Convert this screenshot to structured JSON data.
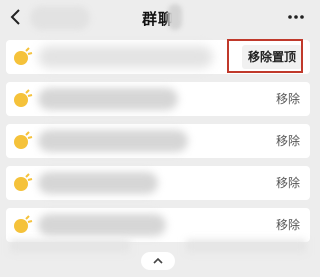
{
  "header": {
    "title": "群聊",
    "back_icon": "chevron-left-icon",
    "more_icon": "more-horizontal-icon"
  },
  "group_list": {
    "items": [
      {
        "avatar_icon": "group-avatar-icon",
        "action_label": "移除置顶",
        "pinned": true
      },
      {
        "avatar_icon": "group-avatar-icon",
        "action_label": "移除",
        "pinned": false
      },
      {
        "avatar_icon": "group-avatar-icon",
        "action_label": "移除",
        "pinned": false
      },
      {
        "avatar_icon": "group-avatar-icon",
        "action_label": "移除",
        "pinned": false
      },
      {
        "avatar_icon": "group-avatar-icon",
        "action_label": "移除",
        "pinned": false
      }
    ]
  },
  "footer": {
    "collapse_icon": "chevron-up-icon"
  },
  "colors": {
    "background": "#ededed",
    "row_background": "#ffffff",
    "avatar_yellow": "#f5c23a",
    "highlight_border": "#c0392b"
  }
}
